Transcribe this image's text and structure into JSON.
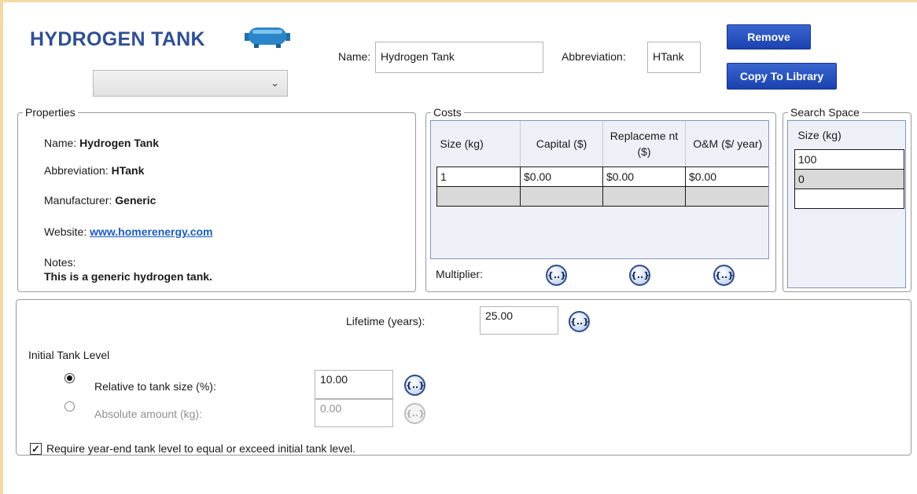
{
  "header": {
    "title": "HYDROGEN TANK",
    "name_label": "Name:",
    "name_value": "Hydrogen Tank",
    "abbr_label": "Abbreviation:",
    "abbr_value": "HTank",
    "remove_label": "Remove",
    "copy_label": "Copy To Library",
    "tank_icon": "hydrogen-tank-icon",
    "combo_value": "",
    "combo_icon": "chevron-down-icon"
  },
  "properties": {
    "legend": "Properties",
    "name_label": "Name:",
    "name_value": "Hydrogen Tank",
    "abbr_label": "Abbreviation:",
    "abbr_value": "HTank",
    "manufacturer_label": "Manufacturer:",
    "manufacturer_value": "Generic",
    "website_label": "Website:",
    "website_value": "www.homerenergy.com",
    "notes_label": "Notes:",
    "notes_value": "This is a generic hydrogen tank."
  },
  "costs": {
    "legend": "Costs",
    "headers": [
      "Size (kg)",
      "Capital ($)",
      "Replaceme nt ($)",
      "O&M ($/ year)"
    ],
    "rows": [
      [
        "1",
        "$0.00",
        "$0.00",
        "$0.00"
      ],
      [
        "",
        "",
        "",
        ""
      ]
    ],
    "multiplier_label": "Multiplier:",
    "multiplier_button": "{..}"
  },
  "search_space": {
    "legend": "Search Space",
    "header": "Size (kg)",
    "values": [
      "100",
      "0",
      ""
    ]
  },
  "settings": {
    "lifetime_label": "Lifetime (years):",
    "lifetime_value": "25.00",
    "initial_level_label": "Initial Tank Level",
    "relative_label": "Relative to tank size (%):",
    "relative_value": "10.00",
    "absolute_label": "Absolute amount (kg):",
    "absolute_value": "0.00",
    "require_label": "Require year-end tank level to equal or exceed initial tank level.",
    "var_button": "{..}",
    "check_mark": "✓"
  },
  "colors": {
    "title": "#2e4f93",
    "button": "#1a42b0",
    "link": "#1a5bc4",
    "frame": "#f3d9a4"
  }
}
